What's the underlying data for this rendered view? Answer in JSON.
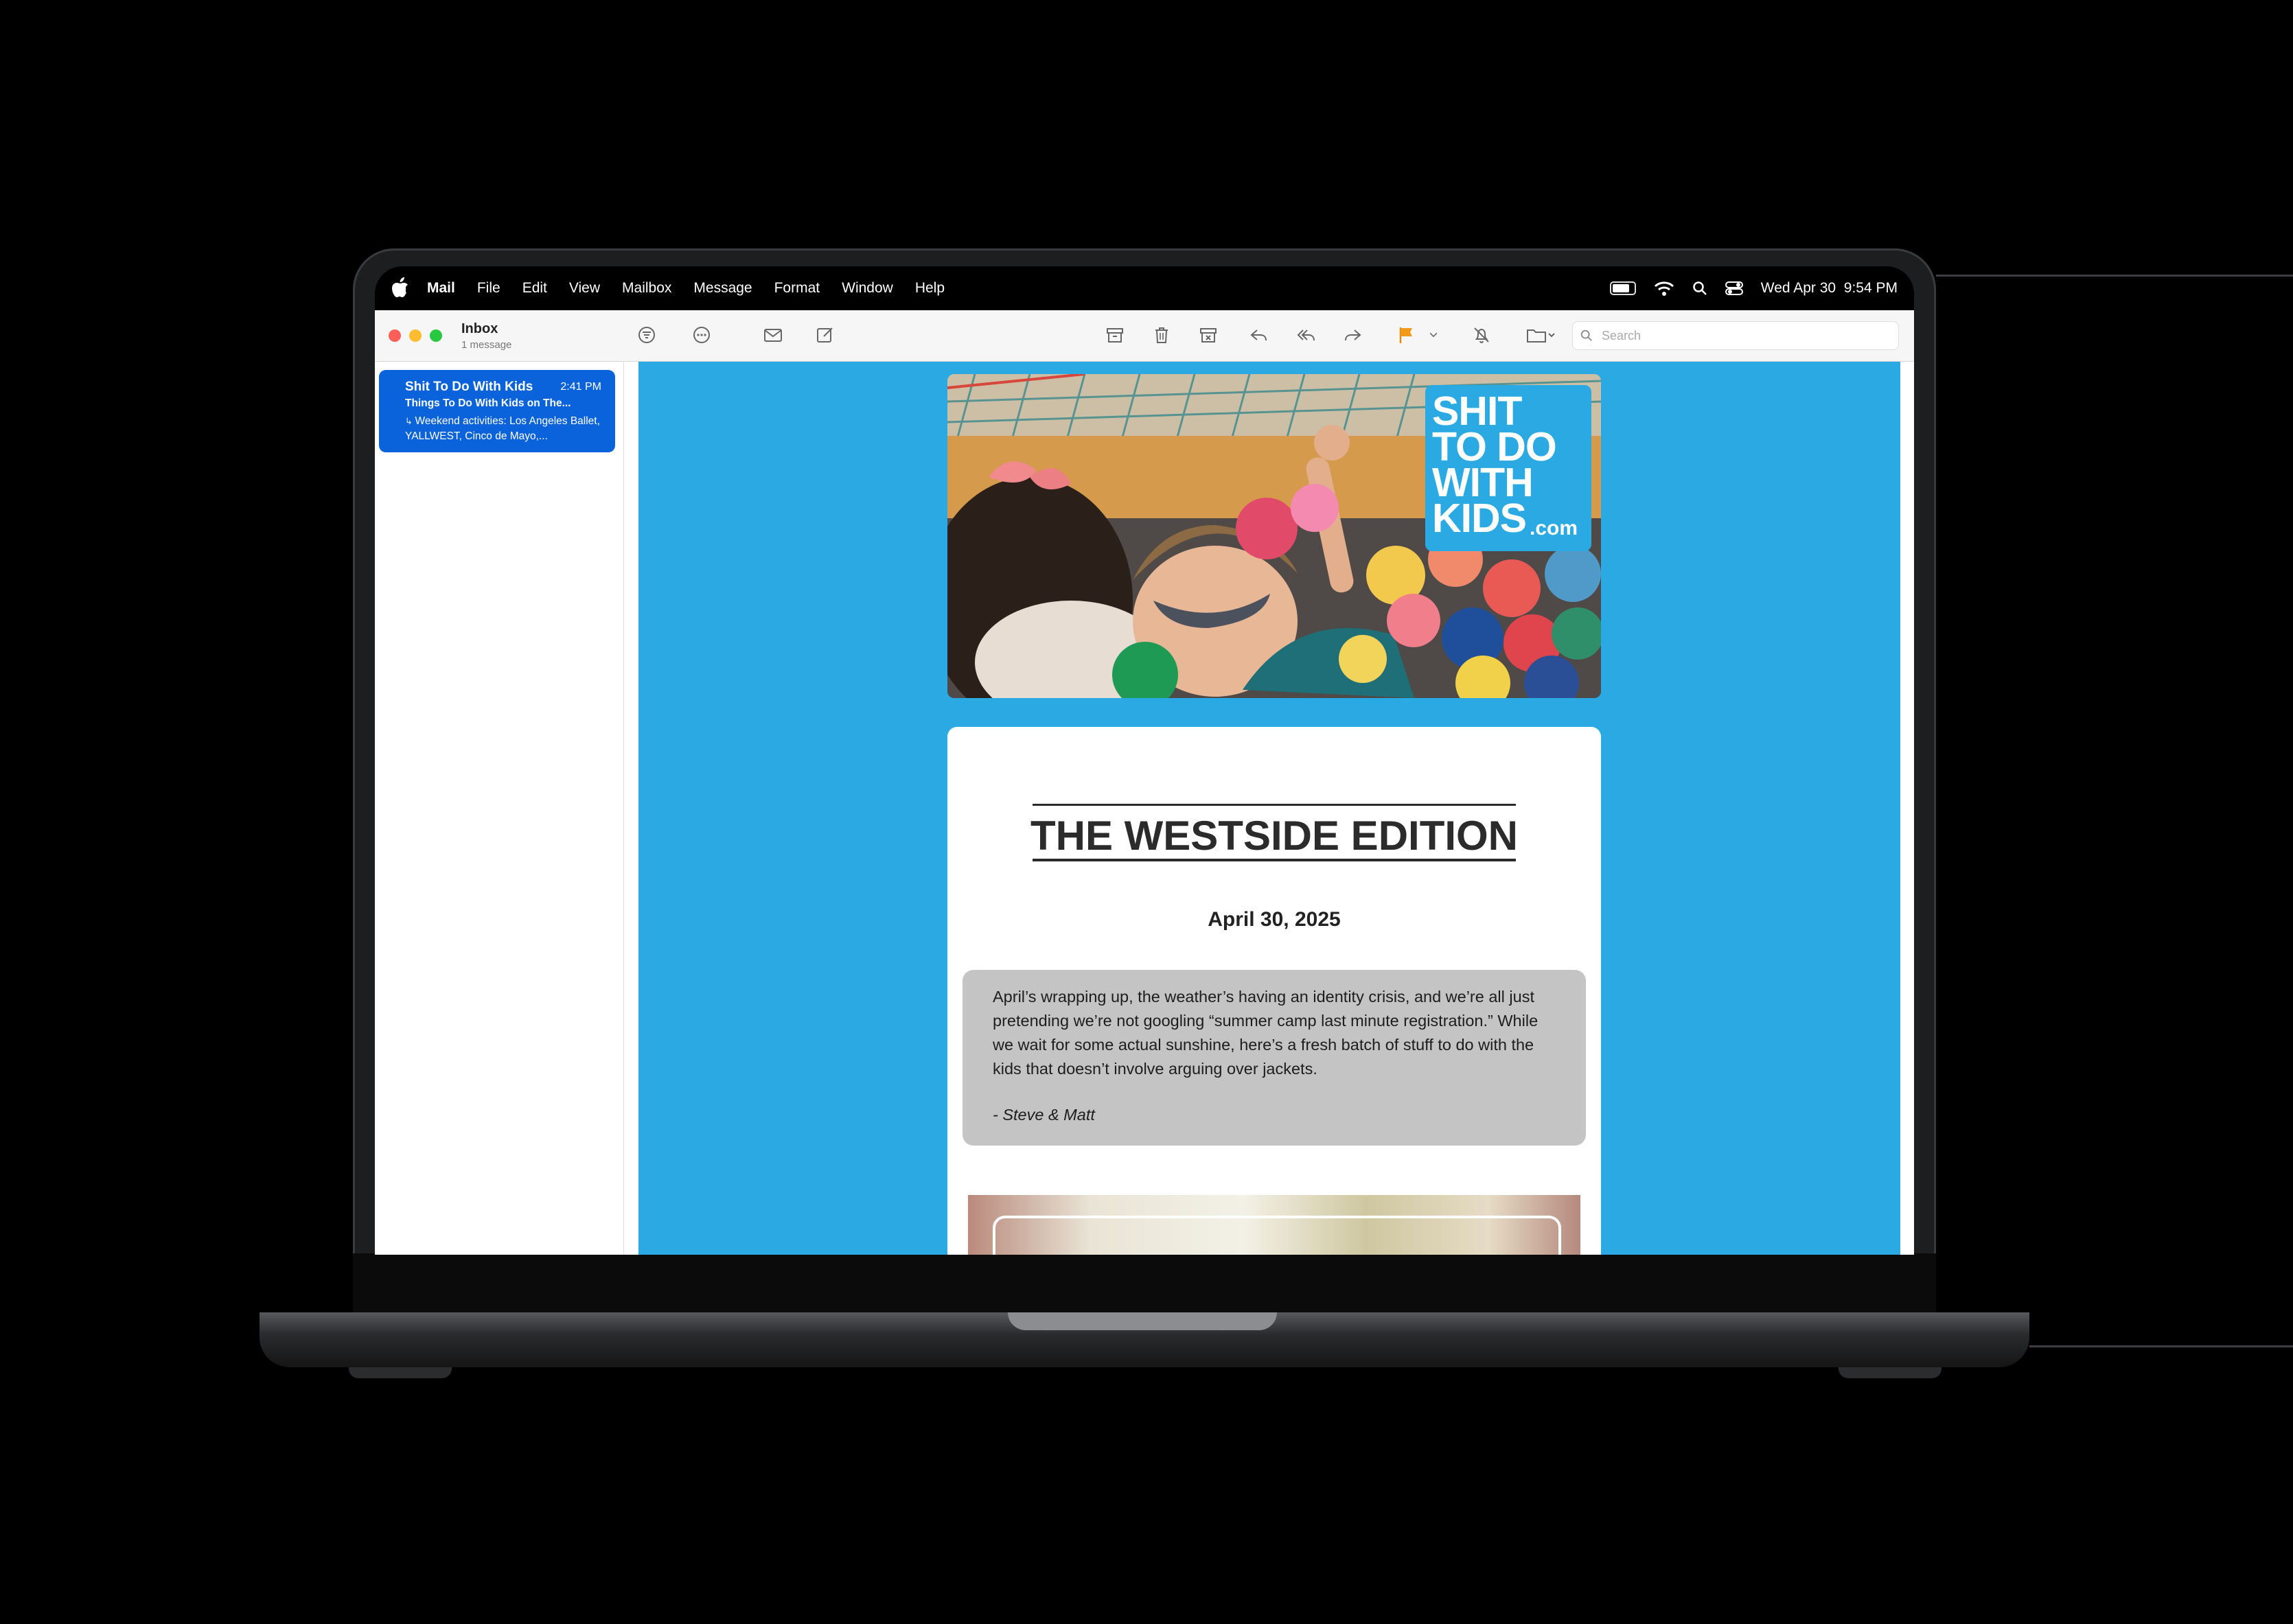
{
  "menubar": {
    "app": "Mail",
    "menus": [
      "File",
      "Edit",
      "View",
      "Mailbox",
      "Message",
      "Format",
      "Window",
      "Help"
    ],
    "clock": "Wed Apr 30  9:54 PM"
  },
  "mailbox": {
    "title": "Inbox",
    "count": "1 message"
  },
  "search": {
    "placeholder": "Search"
  },
  "message": {
    "from": "Shit To Do With Kids",
    "time": "2:41 PM",
    "subject": "Things To Do With Kids on The...",
    "preview": "Weekend activities: Los Angeles Ballet, YALLWEST, Cinco de Mayo,..."
  },
  "email": {
    "logo_lines": [
      "SHIT",
      "TO DO",
      "WITH",
      "KIDS"
    ],
    "logo_suffix": ".com",
    "edition": "THE WESTSIDE EDITION",
    "date": "April 30, 2025",
    "intro": "April’s wrapping up, the weather’s having an identity crisis, and we’re all just pretending we’re not googling “summer camp last minute registration.” While we wait for some actual sunshine, here’s a fresh batch of stuff to do with the kids that doesn’t involve arguing over jackets.",
    "signature": "- Steve & Matt"
  },
  "colors": {
    "email_background": "#2aa9e3",
    "selected_message": "#0a63db",
    "flag": "#f29a17"
  }
}
